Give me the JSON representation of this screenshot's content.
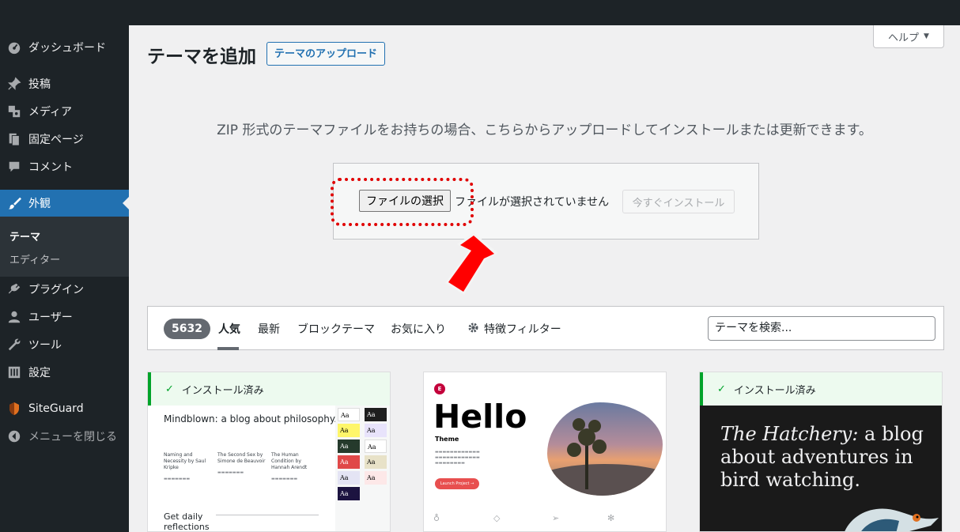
{
  "sidebar": {
    "items": [
      {
        "label": "ダッシュボード",
        "icon": "dashboard-icon"
      },
      {
        "label": "投稿",
        "icon": "pin-icon"
      },
      {
        "label": "メディア",
        "icon": "media-icon"
      },
      {
        "label": "固定ページ",
        "icon": "page-icon"
      },
      {
        "label": "コメント",
        "icon": "comment-icon"
      },
      {
        "label": "外観",
        "icon": "brush-icon"
      },
      {
        "label": "プラグイン",
        "icon": "plugin-icon"
      },
      {
        "label": "ユーザー",
        "icon": "user-icon"
      },
      {
        "label": "ツール",
        "icon": "wrench-icon"
      },
      {
        "label": "設定",
        "icon": "settings-icon"
      },
      {
        "label": "SiteGuard",
        "icon": "siteguard-icon"
      },
      {
        "label": "メニューを閉じる",
        "icon": "collapse-icon"
      }
    ],
    "submenu": [
      "テーマ",
      "エディター"
    ]
  },
  "header": {
    "title": "テーマを追加",
    "upload_button": "テーマのアップロード",
    "help": "ヘルプ"
  },
  "upload": {
    "description": "ZIP 形式のテーマファイルをお持ちの場合、こちらからアップロードしてインストールまたは更新できます。",
    "file_button": "ファイルの選択",
    "file_status": "ファイルが選択されていません",
    "install_button": "今すぐインストール"
  },
  "filter": {
    "count": "5632",
    "tabs": [
      "人気",
      "最新",
      "ブロックテーマ",
      "お気に入り"
    ],
    "feature_filter": "特徴フィルター",
    "search_placeholder": "テーマを検索..."
  },
  "themes": {
    "installed_label": "インストール済み",
    "t1": {
      "heading": "Mindblown: a blog about philosophy.",
      "col1_title": "Naming and Necessity by Saul Kripke",
      "col2_title": "The Second Sex by Simone de Beauvoir",
      "col3_title": "The Human Condition by Hannah Arendt",
      "reflect": "Get daily reflections",
      "swatch": "Aa"
    },
    "t2": {
      "logo": "E",
      "hello": "Hello",
      "theme": "Theme",
      "launch": "Launch Project →"
    },
    "t3": {
      "italic": "The Hatchery:",
      "rest": " a blog about adventures in bird watching."
    }
  },
  "colors": {
    "sidebar_bg": "#1d2327",
    "active": "#2271b1",
    "highlight": "#e00000"
  }
}
